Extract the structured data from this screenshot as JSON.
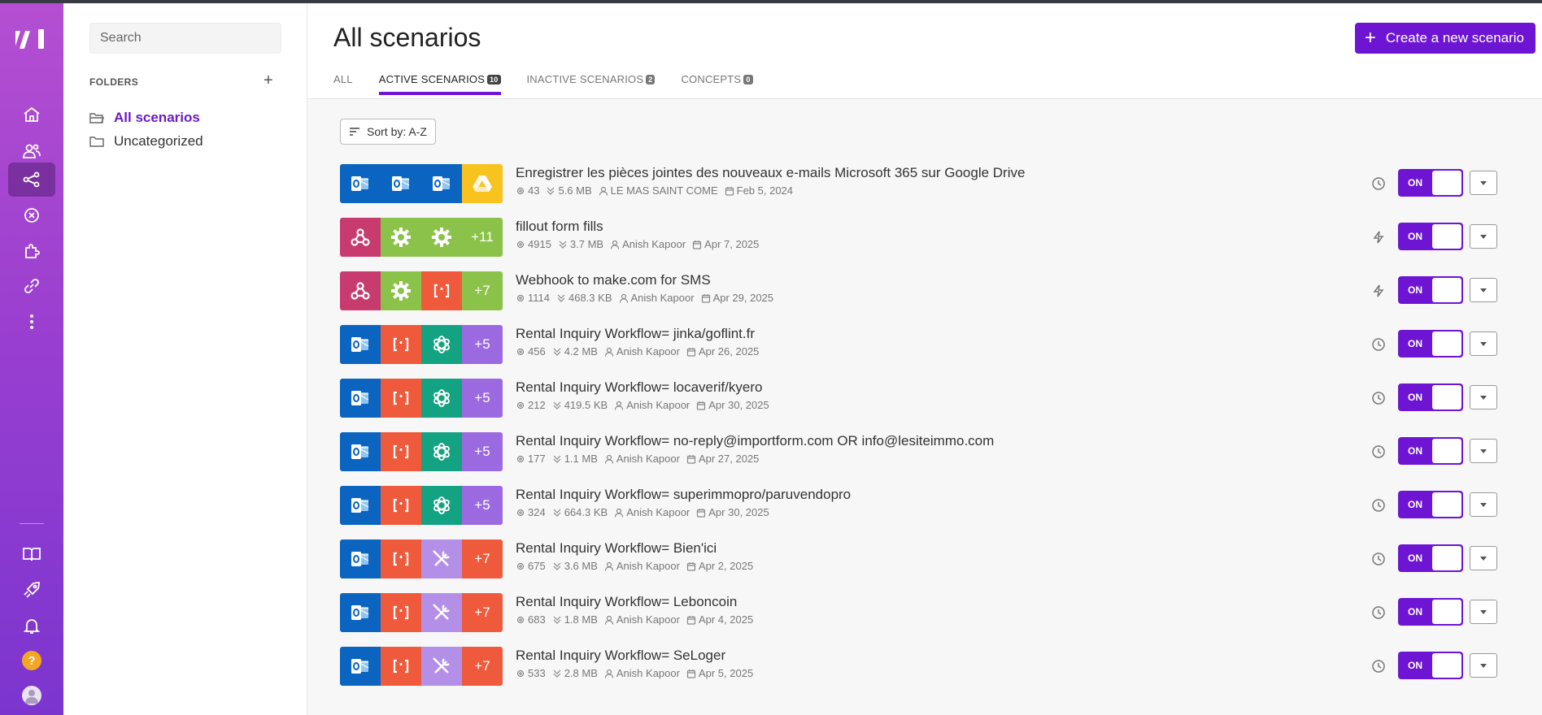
{
  "nav": {
    "items": [
      "home-icon",
      "users-icon",
      "scenarios-icon",
      "connections-icon",
      "apps-icon",
      "webhooks-icon",
      "more-icon",
      "docs-icon",
      "launch-icon",
      "bell-icon",
      "help-icon",
      "avatar"
    ],
    "help_label": "?"
  },
  "sidebar": {
    "search_placeholder": "Search",
    "folders_heading": "FOLDERS",
    "add_label": "+",
    "folders": [
      {
        "label": "All scenarios",
        "active": true
      },
      {
        "label": "Uncategorized",
        "active": false
      }
    ]
  },
  "header": {
    "title": "All scenarios",
    "create_label": "Create a new scenario",
    "tabs": [
      {
        "label": "ALL",
        "count": ""
      },
      {
        "label": "ACTIVE SCENARIOS",
        "count": "10"
      },
      {
        "label": "INACTIVE SCENARIOS",
        "count": "2"
      },
      {
        "label": "CONCEPTS",
        "count": "0"
      }
    ],
    "active_tab": 1
  },
  "sort_label": "Sort by: A-Z",
  "colors": {
    "accent": "#6d15d3",
    "outlook": "#0a64c0",
    "drive": "#f8c21f",
    "webhook": "#c73b6e",
    "tools_green": "#8bc34a",
    "json_red": "#f05a3c",
    "openai": "#13a383",
    "more": "#9c6ae0",
    "tools_purple": "#b48fe8"
  },
  "scenarios": [
    {
      "name": "Enregistrer les pièces jointes des nouveaux e-mails Microsoft 365 sur Google Drive",
      "ops": "43",
      "size": "5.6 MB",
      "owner": "LE MAS SAINT COME",
      "date": "Feb 5, 2024",
      "trigger": "clock",
      "status": "ON",
      "tiles": [
        "outlook",
        "outlook",
        "outlook",
        "drive"
      ],
      "more": ""
    },
    {
      "name": "fillout form fills",
      "ops": "4915",
      "size": "3.7 MB",
      "owner": "Anish Kapoor",
      "date": "Apr 7, 2025",
      "trigger": "bolt",
      "status": "ON",
      "tiles": [
        "webhook",
        "gear",
        "gear"
      ],
      "more": "+11"
    },
    {
      "name": "Webhook to make.com for SMS",
      "ops": "1114",
      "size": "468.3 KB",
      "owner": "Anish Kapoor",
      "date": "Apr 29, 2025",
      "trigger": "bolt",
      "status": "ON",
      "tiles": [
        "webhook",
        "gear",
        "json"
      ],
      "more": "+7"
    },
    {
      "name": "Rental Inquiry Workflow= jinka/goflint.fr",
      "ops": "456",
      "size": "4.2 MB",
      "owner": "Anish Kapoor",
      "date": "Apr 26, 2025",
      "trigger": "clock",
      "status": "ON",
      "tiles": [
        "outlook",
        "json",
        "openai"
      ],
      "more": "+5"
    },
    {
      "name": "Rental Inquiry Workflow= locaverif/kyero",
      "ops": "212",
      "size": "419.5 KB",
      "owner": "Anish Kapoor",
      "date": "Apr 30, 2025",
      "trigger": "clock",
      "status": "ON",
      "tiles": [
        "outlook",
        "json",
        "openai"
      ],
      "more": "+5"
    },
    {
      "name": "Rental Inquiry Workflow= no-reply@importform.com OR info@lesiteimmo.com",
      "ops": "177",
      "size": "1.1 MB",
      "owner": "Anish Kapoor",
      "date": "Apr 27, 2025",
      "trigger": "clock",
      "status": "ON",
      "tiles": [
        "outlook",
        "json",
        "openai"
      ],
      "more": "+5"
    },
    {
      "name": "Rental Inquiry Workflow= superimmopro/paruvendopro",
      "ops": "324",
      "size": "664.3 KB",
      "owner": "Anish Kapoor",
      "date": "Apr 30, 2025",
      "trigger": "clock",
      "status": "ON",
      "tiles": [
        "outlook",
        "json",
        "openai"
      ],
      "more": "+5"
    },
    {
      "name": "Rental Inquiry Workflow= Bien'ici",
      "ops": "675",
      "size": "3.6 MB",
      "owner": "Anish Kapoor",
      "date": "Apr 2, 2025",
      "trigger": "clock",
      "status": "ON",
      "tiles": [
        "outlook",
        "json",
        "tools"
      ],
      "more": "+7"
    },
    {
      "name": "Rental Inquiry Workflow= Leboncoin",
      "ops": "683",
      "size": "1.8 MB",
      "owner": "Anish Kapoor",
      "date": "Apr 4, 2025",
      "trigger": "clock",
      "status": "ON",
      "tiles": [
        "outlook",
        "json",
        "tools"
      ],
      "more": "+7"
    },
    {
      "name": "Rental Inquiry Workflow= SeLoger",
      "ops": "533",
      "size": "2.8 MB",
      "owner": "Anish Kapoor",
      "date": "Apr 5, 2025",
      "trigger": "clock",
      "status": "ON",
      "tiles": [
        "outlook",
        "json",
        "tools"
      ],
      "more": "+7"
    }
  ]
}
